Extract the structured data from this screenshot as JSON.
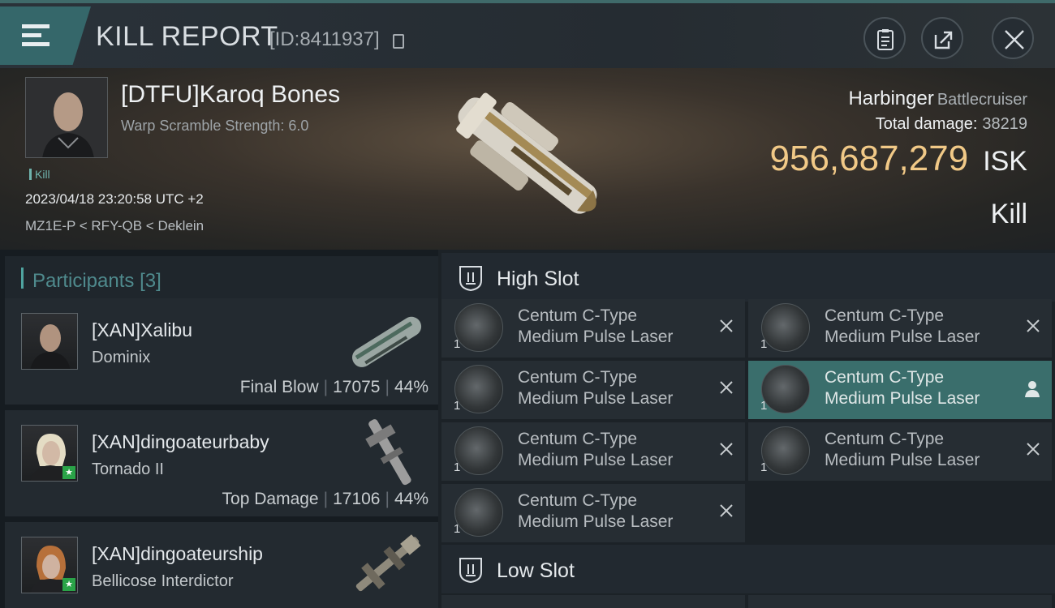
{
  "header": {
    "title": "KILL REPORT",
    "id_text": "[ID:8411937]"
  },
  "victim": {
    "name": "[DTFU]Karoq Bones",
    "warp_scramble": "Warp Scramble Strength: 6.0",
    "kill_tag": "Kill",
    "datetime": "2023/04/18 23:20:58 UTC +2",
    "location": "MZ1E-P < RFY-QB < Deklein",
    "ship_name": "Harbinger",
    "ship_class": "Battlecruiser",
    "total_damage_label": "Total damage:",
    "total_damage": "38219",
    "isk_value": "956,687,279",
    "isk_unit": "ISK",
    "result": "Kill"
  },
  "participants": {
    "label": "Participants",
    "count": "[3]",
    "rows": [
      {
        "name": "[XAN]Xalibu",
        "ship": "Dominix",
        "tag": "Final Blow",
        "damage": "17075",
        "percent": "44%"
      },
      {
        "name": "[XAN]dingoateurbaby",
        "ship": "Tornado II",
        "tag": "Top Damage",
        "damage": "17106",
        "percent": "44%"
      },
      {
        "name": "[XAN]dingoateurship",
        "ship": "Bellicose Interdictor",
        "tag": "",
        "damage": "",
        "percent": ""
      }
    ]
  },
  "high_slot": {
    "label": "High Slot",
    "modules": [
      {
        "line1": "Centum C-Type",
        "line2": "Medium Pulse Laser",
        "qty": "1"
      },
      {
        "line1": "Centum C-Type",
        "line2": "Medium Pulse Laser",
        "qty": "1"
      },
      {
        "line1": "Centum C-Type",
        "line2": "Medium Pulse Laser",
        "qty": "1"
      },
      {
        "line1": "Centum C-Type",
        "line2": "Medium Pulse Laser",
        "qty": "1"
      },
      {
        "line1": "Centum C-Type",
        "line2": "Medium Pulse Laser",
        "qty": "1"
      },
      {
        "line1": "Centum C-Type",
        "line2": "Medium Pulse Laser",
        "qty": "1"
      },
      {
        "line1": "Centum C-Type",
        "line2": "Medium Pulse Laser",
        "qty": "1"
      }
    ]
  },
  "low_slot": {
    "label": "Low Slot"
  },
  "colors": {
    "accent_teal": "#35676a",
    "isk_gold": "#f1c987",
    "active_module": "#3a6e6c",
    "badge_green": "#2aa348"
  },
  "icons": [
    "menu-icon",
    "clipboard-icon",
    "share-icon",
    "close-icon",
    "copy-icon",
    "slot-icon",
    "remove-icon",
    "person-icon"
  ]
}
